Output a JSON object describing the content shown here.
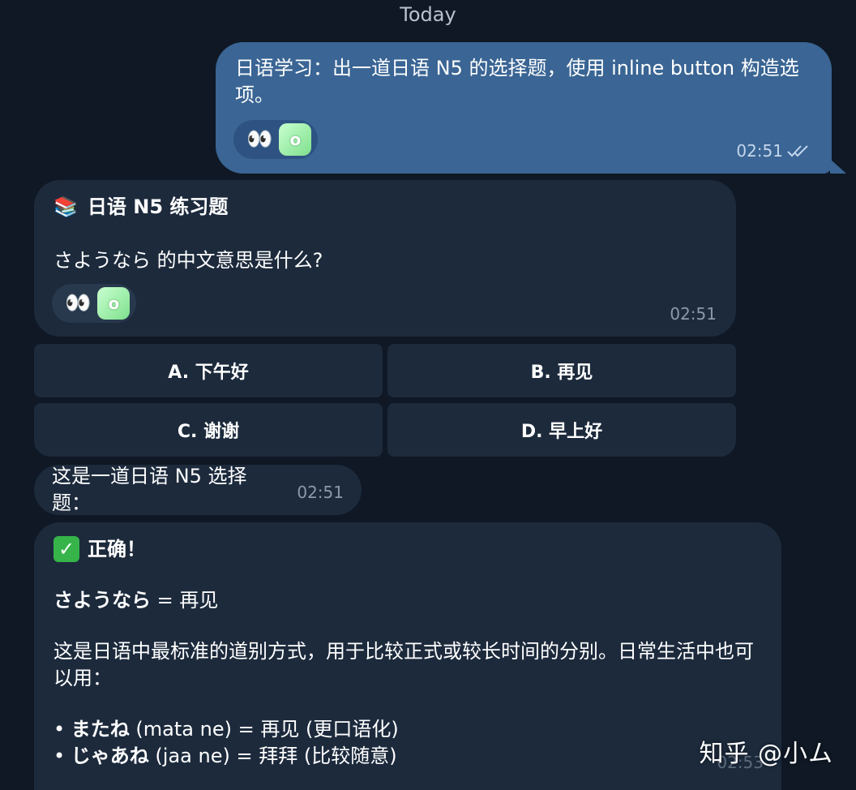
{
  "date_divider": "Today",
  "outgoing": {
    "text": "日语学习：出一道日语 N5 的选择题，使用 inline button 构造选项。",
    "reactions": {
      "emoji": "👀",
      "avatar_letter": "o"
    },
    "time": "02:51",
    "status_icon": "double-check-icon"
  },
  "question": {
    "title_icon": "📚",
    "title": "日语 N5 练习题",
    "question": "さようなら 的中文意思是什么?",
    "reactions": {
      "emoji": "👀",
      "avatar_letter": "o"
    },
    "time": "02:51"
  },
  "keyboard": {
    "a": "A. 下午好",
    "b": "B. 再见",
    "c": "C. 谢谢",
    "d": "D. 早上好"
  },
  "note": {
    "text": "这是一道日语 N5 选择题：",
    "time": "02:51"
  },
  "answer": {
    "title": "正确！",
    "eq_jp": "さようなら",
    "eq_rest": " = 再见",
    "desc": "这是日语中最标准的道别方式，用于比较正式或较长时间的分别。日常生活中也可以用：",
    "list": [
      {
        "jp": "またね",
        "rest": " (mata ne) = 再见 (更口语化)"
      },
      {
        "jp": "じゃあね",
        "rest": " (jaa ne) = 拜拜 (比较随意)"
      }
    ],
    "time": "02:53"
  },
  "watermark": "知乎 @小ム",
  "colors": {
    "background": "#0f1824",
    "outgoing_bubble": "#3a6594",
    "incoming_bubble": "#1c2a3c",
    "check": "#36b44a"
  }
}
